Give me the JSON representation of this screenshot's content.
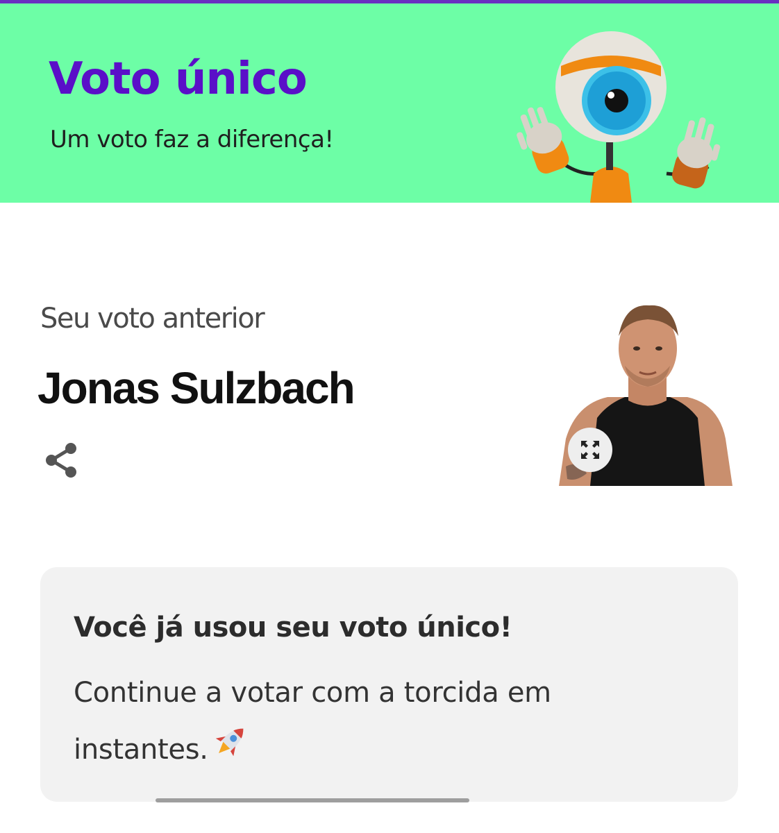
{
  "banner": {
    "title": "Voto único",
    "subtitle": "Um voto faz a diferença!",
    "background": "#6dfea6",
    "title_color": "#5a0fc8"
  },
  "previous_vote": {
    "label": "Seu voto anterior",
    "name": "Jonas Sulzbach",
    "share_icon": "share-icon",
    "expand_icon": "expand-icon"
  },
  "notice": {
    "title": "Você já usou seu voto único!",
    "body": "Continue a votar com a torcida em instantes.",
    "icon": "rocket-icon"
  }
}
